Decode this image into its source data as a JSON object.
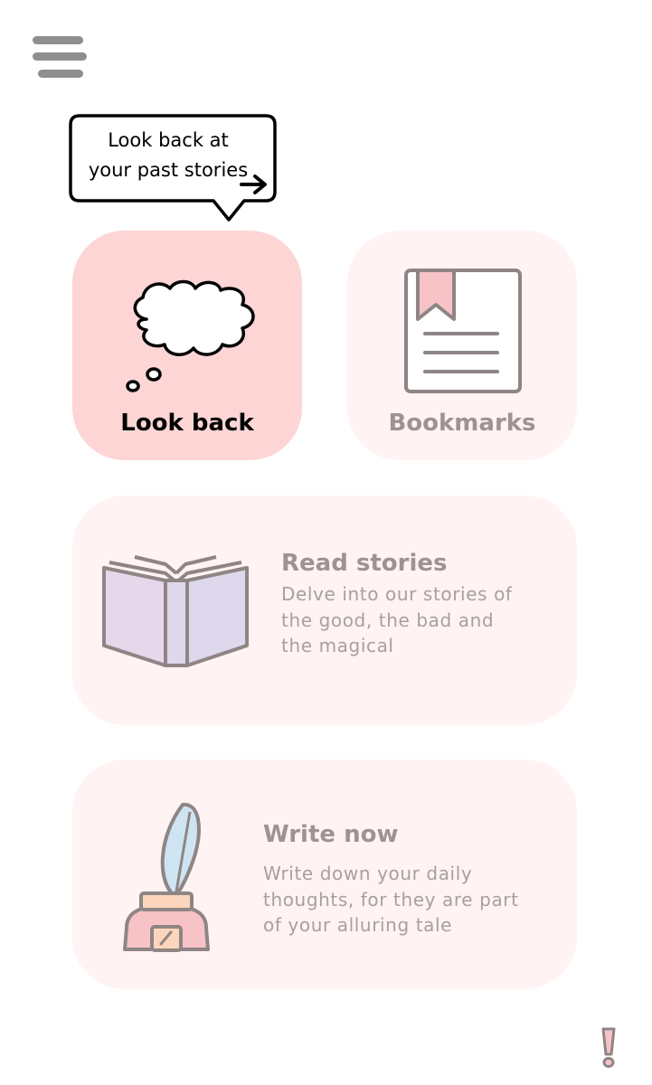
{
  "header": {
    "menu_icon": "hamburger-menu-icon"
  },
  "tooltip": {
    "text": "Look back at\nyour past stories",
    "arrow_icon": "arrow-right-icon"
  },
  "cards": {
    "look_back": {
      "label": "Look back",
      "icon": "thought-cloud-icon"
    },
    "bookmarks": {
      "label": "Bookmarks",
      "icon": "bookmark-page-icon"
    },
    "read_stories": {
      "title": "Read stories",
      "description": "Delve into our stories of\nthe good, the bad and\nthe magical",
      "icon": "open-book-icon"
    },
    "write_now": {
      "title": "Write now",
      "description": "Write down your daily\nthoughts, for they are part\nof your alluring tale",
      "icon": "quill-inkwell-icon"
    }
  },
  "footer": {
    "alert_icon": "exclamation-icon"
  },
  "colors": {
    "active_card": "#fdd5d5",
    "inactive_card": "#fff3f3",
    "muted_text": "#9e9393",
    "icon_stroke": "#8f8585"
  }
}
